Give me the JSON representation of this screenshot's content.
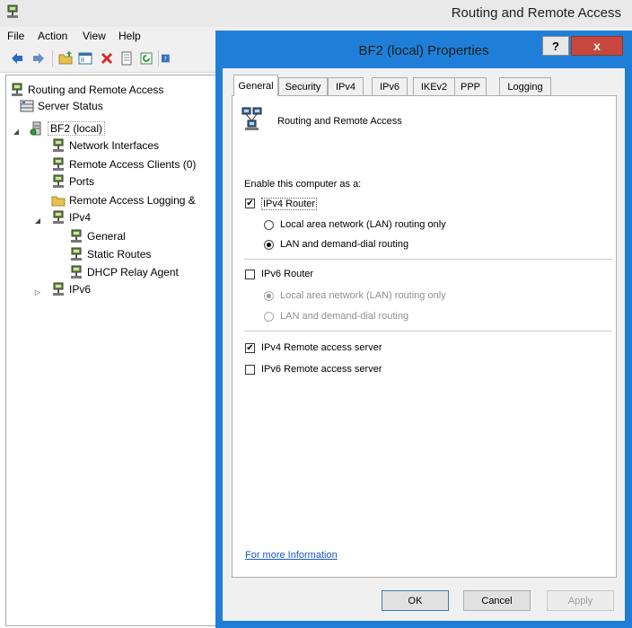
{
  "window": {
    "title": "Routing and Remote Access"
  },
  "menu": [
    "File",
    "Action",
    "View",
    "Help"
  ],
  "tree": {
    "root": "Routing and Remote Access",
    "server_status": "Server Status",
    "server": "BF2 (local)",
    "network_interfaces": "Network Interfaces",
    "remote_access_clients": "Remote Access Clients (0)",
    "ports": "Ports",
    "remote_access_logging": "Remote Access Logging &",
    "ipv4": "IPv4",
    "general": "General",
    "static_routes": "Static Routes",
    "dhcp_relay_agent": "DHCP Relay Agent",
    "ipv6": "IPv6"
  },
  "dialog": {
    "title": "BF2 (local) Properties",
    "help": "?",
    "close": "x",
    "tabs": [
      "General",
      "Security",
      "IPv4",
      "IPv6",
      "IKEv2",
      "PPP",
      "Logging"
    ],
    "active_tab": "General",
    "header_text": "Routing and Remote Access",
    "enable_label": "Enable this computer as a:",
    "ipv4_router": {
      "label": "IPv4 Router",
      "checked": true
    },
    "ipv4_lan_only": {
      "label": "Local area network (LAN) routing only",
      "selected": false
    },
    "ipv4_lan_demand": {
      "label": "LAN and demand-dial routing",
      "selected": true
    },
    "ipv6_router": {
      "label": "IPv6 Router",
      "checked": false
    },
    "ipv6_lan_only": {
      "label": "Local area network (LAN) routing only",
      "selected": true,
      "disabled": true
    },
    "ipv6_lan_demand": {
      "label": "LAN and demand-dial routing",
      "selected": false,
      "disabled": true
    },
    "ipv4_ras": {
      "label": "IPv4 Remote access server",
      "checked": true
    },
    "ipv6_ras": {
      "label": "IPv6 Remote access server",
      "checked": false
    },
    "info_link": "For more Information",
    "buttons": {
      "ok": "OK",
      "cancel": "Cancel",
      "apply": "Apply"
    }
  },
  "colors": {
    "dialog_frame": "#1f7fd8",
    "close": "#c7463d",
    "link": "#1a56c8"
  }
}
